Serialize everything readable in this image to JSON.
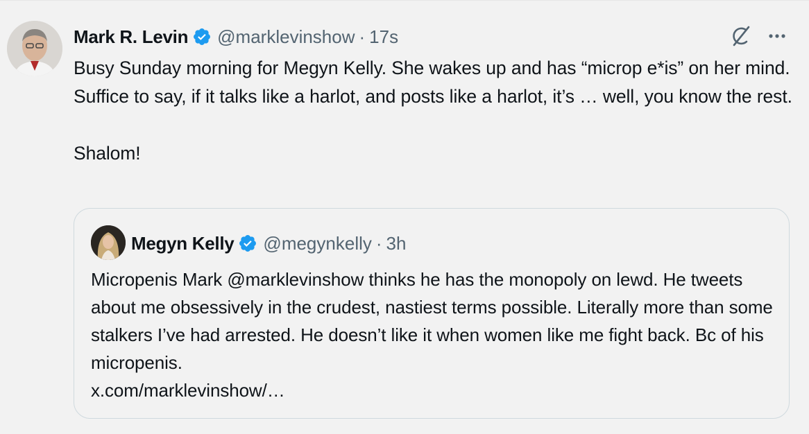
{
  "tweet": {
    "author_name": "Mark R. Levin",
    "handle": "@marklevinshow",
    "separator": "·",
    "time": "17s",
    "text": "Busy Sunday morning for Megyn Kelly. She wakes up and has “microp e*is” on her mind.  Suffice to say, if it talks like a harlot, and posts like a harlot, it’s … well, you know the rest.\n\nShalom!"
  },
  "quoted_tweet": {
    "author_name": "Megyn Kelly",
    "handle": "@megynkelly",
    "separator": "·",
    "time": "3h",
    "text": "Micropenis Mark @marklevinshow thinks he has the monopoly on lewd. He tweets about me obsessively in the crudest, nastiest terms possible. Literally more than some stalkers I’ve had arrested. He doesn’t like it when women like me fight back. Bc of his micropenis.\nx.com/marklevinshow/…"
  },
  "icons": {
    "verified": "verified-badge-icon",
    "grok": "grok-icon",
    "more": "more-options-icon"
  },
  "colors": {
    "background": "#f2f2f2",
    "verified_blue": "#1d9bf0",
    "secondary_text": "#536471",
    "primary_text": "#0f1419",
    "border": "#cfd9de"
  }
}
